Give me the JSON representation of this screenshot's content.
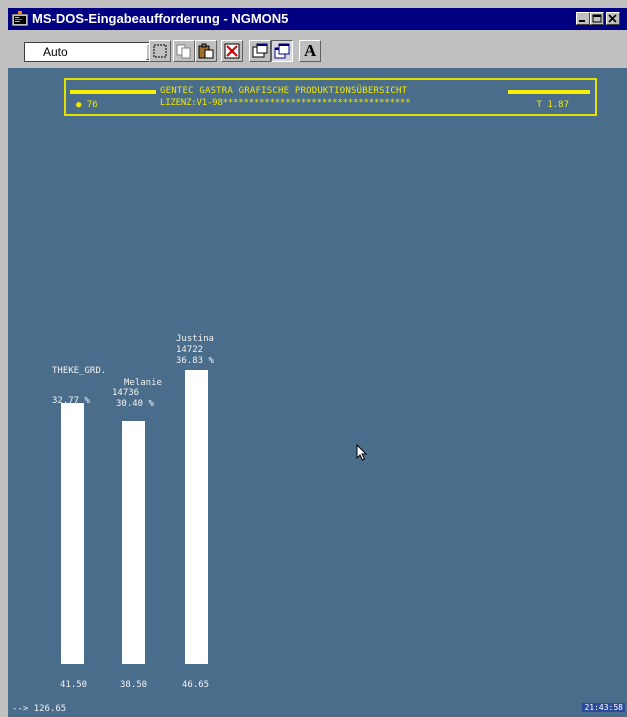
{
  "window": {
    "title": "MS-DOS-Eingabeaufforderung - NGMON5",
    "controls": [
      "minimize",
      "maximize",
      "close"
    ]
  },
  "toolbar": {
    "font_size_value": "Auto",
    "tools": [
      "mark-icon",
      "copy-icon",
      "paste-icon",
      "fullscreen-icon",
      "properties-icon",
      "background-icon",
      "font-icon"
    ],
    "font_button_label": "A"
  },
  "screen": {
    "header": {
      "title": "GENTEC GASTRA GRAFISCHE PRODUKTIONSÜBERSICHT",
      "license": "LIZENZ:V1-98************************************",
      "left_indicator": "● 76",
      "right_indicator": "T 1.87"
    },
    "bars": [
      {
        "name": "THEKE_GRD.",
        "count": "",
        "percent_line": "32.77 %",
        "value": 41.5
      },
      {
        "name": "Melanie",
        "count": "14736",
        "percent_line": "30.40 %",
        "value": 38.5
      },
      {
        "name": "Justina",
        "count": "14722",
        "percent_line": "36.83 %",
        "value": 46.65
      }
    ],
    "bar_bottom_labels": [
      "41.50",
      "38.50",
      "46.65"
    ],
    "total": "126.65",
    "status_prefix": "-->",
    "clock": "21:43:58"
  },
  "colors": {
    "screen_bg": "#4a6d8c",
    "header_yellow": "#f0e800",
    "bar_white": "#ffffff",
    "titlebar": "#000080"
  }
}
